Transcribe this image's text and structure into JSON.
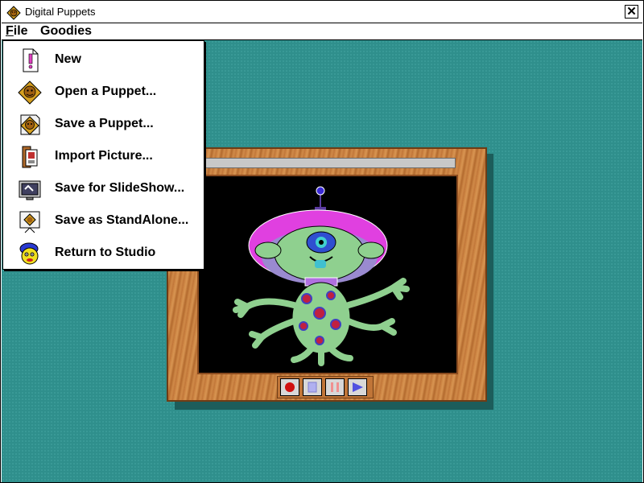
{
  "window": {
    "title": "Digital Puppets",
    "close_glyph": "✕"
  },
  "menubar": {
    "file": {
      "label_first": "F",
      "label_rest": "ile"
    },
    "goodies": {
      "label": "Goodies"
    }
  },
  "file_menu": {
    "items": [
      {
        "label": "New",
        "icon": "new-document-icon"
      },
      {
        "label": "Open a Puppet...",
        "icon": "open-puppet-icon"
      },
      {
        "label": "Save a Puppet...",
        "icon": "save-puppet-icon"
      },
      {
        "label": "Import Picture...",
        "icon": "import-picture-icon"
      },
      {
        "label": "Save for SlideShow...",
        "icon": "slideshow-icon"
      },
      {
        "label": "Save as StandAlone...",
        "icon": "standalone-icon"
      },
      {
        "label": "Return to Studio",
        "icon": "studio-character-icon"
      }
    ]
  },
  "stage": {
    "puppet": "alien-puppet",
    "controls": [
      "record",
      "stop",
      "pause",
      "play"
    ]
  },
  "colors": {
    "desktop": "#2f8f8c",
    "frame_wood": "#c9803f",
    "canvas": "#000000"
  }
}
